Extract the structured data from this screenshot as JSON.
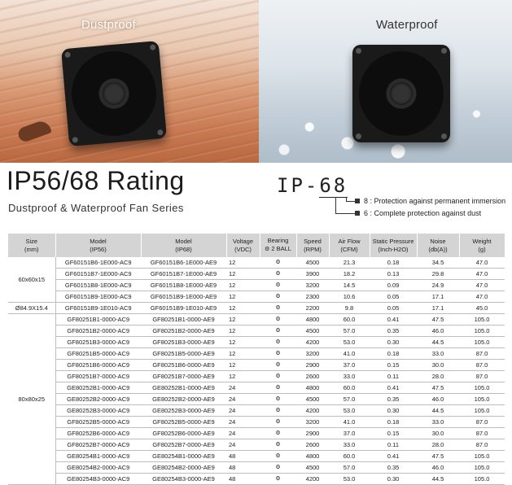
{
  "hero": {
    "dust_label": "Dustproof",
    "water_label": "Waterproof"
  },
  "headline": {
    "title": "IP56/68 Rating",
    "subtitle": "Dustproof & Waterproof Fan Series"
  },
  "ip_code": {
    "prefix": "IP-",
    "digits": "68",
    "notes": [
      "8 : Protection against permanent immersion",
      "6 : Complete protection against dust"
    ]
  },
  "table": {
    "headers": [
      {
        "title": "Size",
        "unit": "(mm)"
      },
      {
        "title": "Model",
        "unit": "(IP56)"
      },
      {
        "title": "Model",
        "unit": "(IP68)"
      },
      {
        "title": "Voltage",
        "unit": "(VDC)"
      },
      {
        "title": "Bearing",
        "unit": "2 BALL"
      },
      {
        "title": "Speed",
        "unit": "(RPM)"
      },
      {
        "title": "Air Flow",
        "unit": "(CFM)"
      },
      {
        "title": "Static Pressure",
        "unit": "(Inch-H2O)"
      },
      {
        "title": "Noise",
        "unit": "(db(A))"
      },
      {
        "title": "Weight",
        "unit": "(g)"
      }
    ],
    "groups": [
      {
        "size": "60x60x15",
        "rows": [
          [
            "GF60151B6-1E000-AC9",
            "GF60151B6-1E000-AE9",
            "12",
            "4500",
            "21.3",
            "0.18",
            "34.5",
            "47.0"
          ],
          [
            "GF60151B7-1E000-AC9",
            "GF60151B7-1E000-AE9",
            "12",
            "3900",
            "18.2",
            "0.13",
            "29.8",
            "47.0"
          ],
          [
            "GF60151B8-1E000-AC9",
            "GF60151B8-1E000-AE9",
            "12",
            "3200",
            "14.5",
            "0.09",
            "24.9",
            "47.0"
          ],
          [
            "GF60151B9-1E000-AC9",
            "GF60151B9-1E000-AE9",
            "12",
            "2300",
            "10.6",
            "0.05",
            "17.1",
            "47.0"
          ]
        ]
      },
      {
        "size": "Ø84.9X15.4",
        "rows": [
          [
            "GF60151B9-1E010-AC9",
            "GF60151B9-1E010-AE9",
            "12",
            "2200",
            "9.8",
            "0.05",
            "17.1",
            "45.0"
          ]
        ]
      },
      {
        "size": "80x80x25",
        "rows": [
          [
            "GF80251B1-0000-AC9",
            "GF80251B1-0000-AE9",
            "12",
            "4800",
            "60.0",
            "0.41",
            "47.5",
            "105.0"
          ],
          [
            "GF80251B2-0000-AC9",
            "GF80251B2-0000-AE9",
            "12",
            "4500",
            "57.0",
            "0.35",
            "46.0",
            "105.0"
          ],
          [
            "GF80251B3-0000-AC9",
            "GF80251B3-0000-AE9",
            "12",
            "4200",
            "53.0",
            "0.30",
            "44.5",
            "105.0"
          ],
          [
            "GF80251B5-0000-AC9",
            "GF80251B5-0000-AE9",
            "12",
            "3200",
            "41.0",
            "0.18",
            "33.0",
            "87.0"
          ],
          [
            "GF80251B6-0000-AC9",
            "GF80251B6-0000-AE9",
            "12",
            "2900",
            "37.0",
            "0.15",
            "30.0",
            "87.0"
          ],
          [
            "GF80251B7-0000-AC9",
            "GF80251B7-0000-AE9",
            "12",
            "2600",
            "33.0",
            "0.11",
            "28.0",
            "87.0"
          ],
          [
            "GE80252B1-0000-AC9",
            "GE80252B1-0000-AE9",
            "24",
            "4800",
            "60.0",
            "0.41",
            "47.5",
            "105.0"
          ],
          [
            "GE80252B2-0000-AC9",
            "GE80252B2-0000-AE9",
            "24",
            "4500",
            "57.0",
            "0.35",
            "46.0",
            "105.0"
          ],
          [
            "GE80252B3-0000-AC9",
            "GE80252B3-0000-AE9",
            "24",
            "4200",
            "53.0",
            "0.30",
            "44.5",
            "105.0"
          ],
          [
            "GF80252B5-0000-AC9",
            "GF80252B5-0000-AE9",
            "24",
            "3200",
            "41.0",
            "0.18",
            "33.0",
            "87.0"
          ],
          [
            "GF80252B6-0000-AC9",
            "GF80252B6-0000-AE9",
            "24",
            "2900",
            "37.0",
            "0.15",
            "30.0",
            "87.0"
          ],
          [
            "GF80252B7-0000-AC9",
            "GF80252B7-0000-AE9",
            "24",
            "2600",
            "33.0",
            "0.11",
            "28.0",
            "87.0"
          ],
          [
            "GE80254B1-0000-AC9",
            "GE80254B1-0000-AE9",
            "48",
            "4800",
            "60.0",
            "0.41",
            "47.5",
            "105.0"
          ],
          [
            "GE80254B2-0000-AC9",
            "GE80254B2-0000-AE9",
            "48",
            "4500",
            "57.0",
            "0.35",
            "46.0",
            "105.0"
          ],
          [
            "GE80254B3-0000-AC9",
            "GE80254B3-0000-AE9",
            "48",
            "4200",
            "53.0",
            "0.30",
            "44.5",
            "105.0"
          ]
        ]
      }
    ],
    "bearing_icon": "ball-bearing-icon"
  },
  "colors": {
    "header_bg": "#d4d4d4",
    "row_rule": "#bdbdbd",
    "sand": "#d99a74",
    "water": "#c3ced8"
  }
}
